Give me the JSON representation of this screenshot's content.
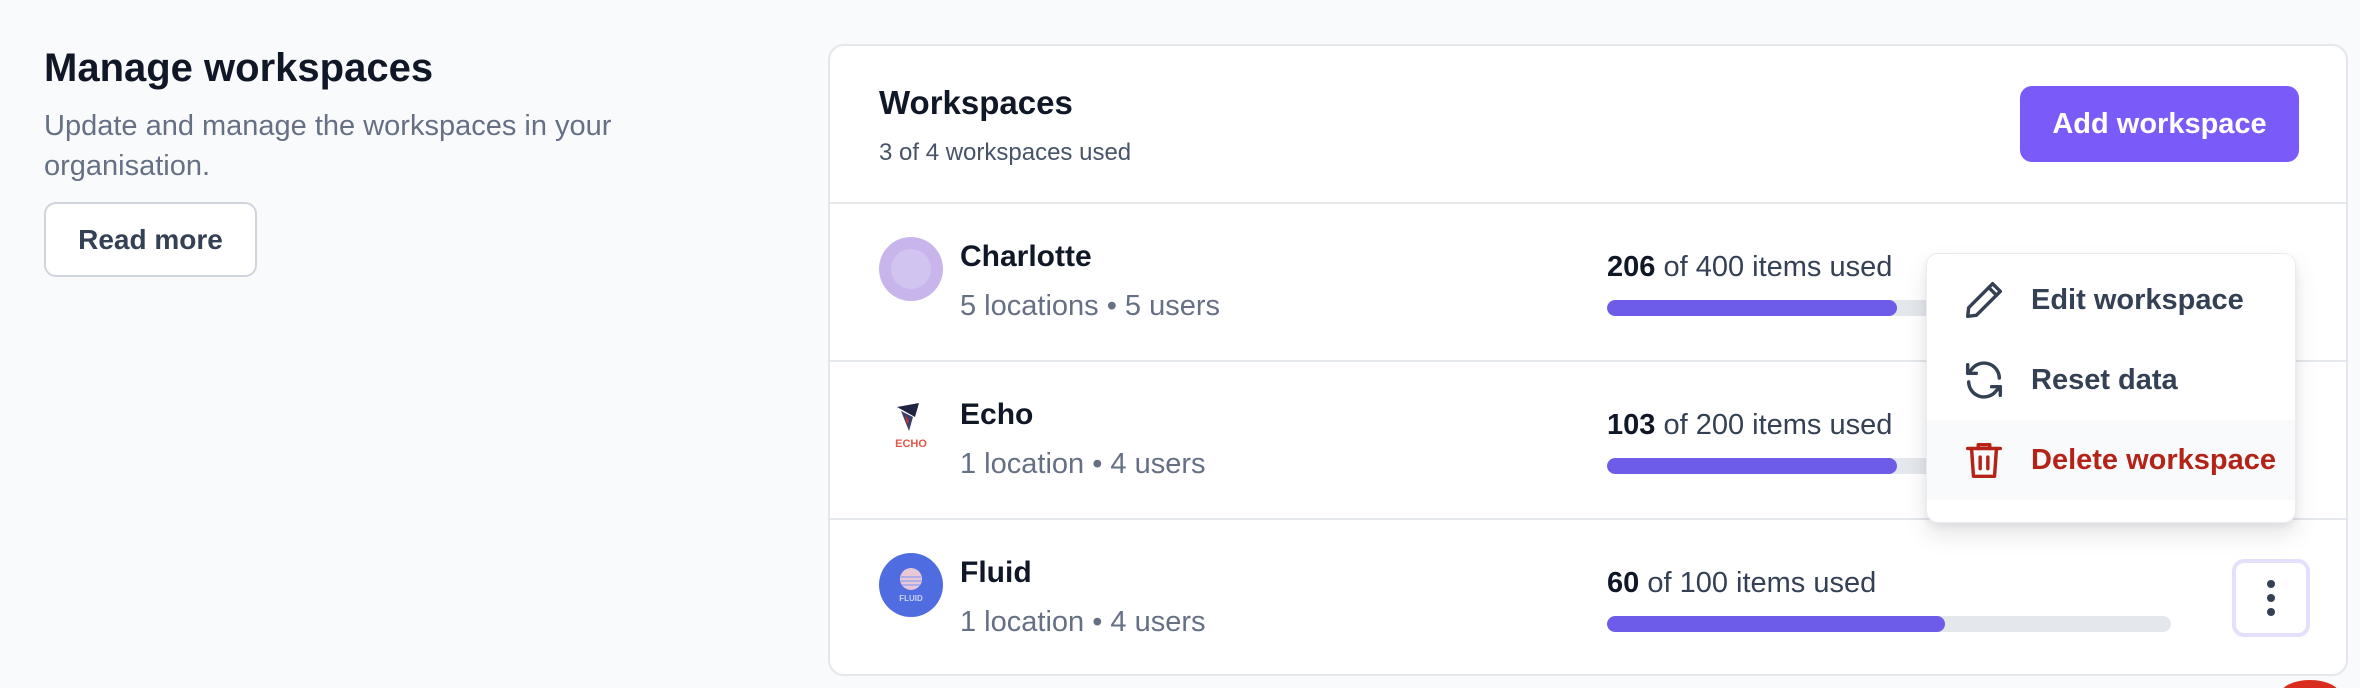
{
  "intro": {
    "title": "Manage workspaces",
    "description": "Update and manage the workspaces in your organisation.",
    "read_more_label": "Read more"
  },
  "card": {
    "title": "Workspaces",
    "subtitle": "3 of 4 workspaces used",
    "add_button_label": "Add workspace"
  },
  "workspaces": [
    {
      "name": "Charlotte",
      "meta": "5 locations • 5 users",
      "used": "206",
      "usage_rest": " of 400 items used",
      "fraction": 0.515
    },
    {
      "name": "Echo",
      "meta": "1 location • 4 users",
      "used": "103",
      "usage_rest": " of 200 items used",
      "fraction": 0.515,
      "logo_text": "ECHO"
    },
    {
      "name": "Fluid",
      "meta": "1 location • 4 users",
      "used": "60",
      "usage_rest": " of 100 items used",
      "fraction": 0.6,
      "logo_text": "FLUID"
    }
  ],
  "menu": {
    "items": [
      {
        "label": "Edit workspace",
        "icon": "pencil-icon"
      },
      {
        "label": "Reset data",
        "icon": "refresh-icon"
      },
      {
        "label": "Delete workspace",
        "icon": "trash-icon"
      }
    ]
  },
  "colors": {
    "accent": "#7a5af8",
    "bar_fill": "#6c5ce7",
    "danger": "#b42318"
  }
}
